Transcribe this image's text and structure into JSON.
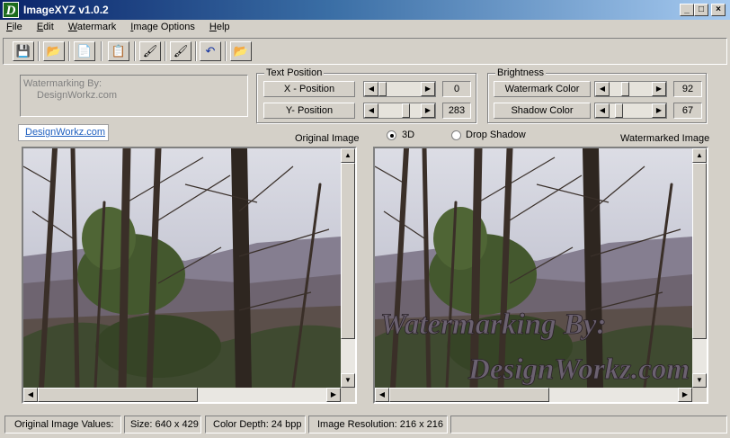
{
  "window": {
    "title": "ImageXYZ v1.0.2",
    "icon_letter": "D",
    "minimize": "_",
    "maximize": "□",
    "close": "×"
  },
  "menu": [
    {
      "label": "File",
      "u": "F"
    },
    {
      "label": "Edit",
      "u": "E"
    },
    {
      "label": "Watermark",
      "u": "W"
    },
    {
      "label": "Image Options",
      "u": "I"
    },
    {
      "label": "Help",
      "u": "H"
    }
  ],
  "toolbar": {
    "icons": [
      "save-icon",
      "open-icon",
      "copy-icon",
      "paste-icon",
      "brush-icon",
      "brush-clear-icon",
      "undo-icon",
      "open-folder-icon"
    ],
    "glyphs": [
      "💾",
      "📂",
      "📄",
      "📋",
      "🖌",
      "🖌",
      "↶",
      "📂"
    ]
  },
  "watermark_text": {
    "line1": "Watermarking By:",
    "line2": "DesignWorkz.com"
  },
  "link": "DesignWorkz.com",
  "text_position": {
    "title": "Text Position",
    "x_label": "X - Position",
    "x_value": "0",
    "y_label": "Y- Position",
    "y_value": "283"
  },
  "brightness": {
    "title": "Brightness",
    "wm_label": "Watermark Color",
    "wm_value": "92",
    "shadow_label": "Shadow Color",
    "shadow_value": "67"
  },
  "labels": {
    "original": "Original Image",
    "watermarked": "Watermarked Image",
    "radio_3d": "3D",
    "radio_shadow": "Drop Shadow"
  },
  "overlay": {
    "line1": "Watermarking By:",
    "line2": "DesignWorkz.com"
  },
  "status": {
    "s1": "Original Image Values:",
    "s2": "Size: 640 x 429",
    "s3": "Color Depth: 24 bpp",
    "s4": "Image Resolution: 216 x 216"
  },
  "arrows": {
    "left": "◀",
    "right": "▶",
    "up": "▲",
    "down": "▼"
  }
}
